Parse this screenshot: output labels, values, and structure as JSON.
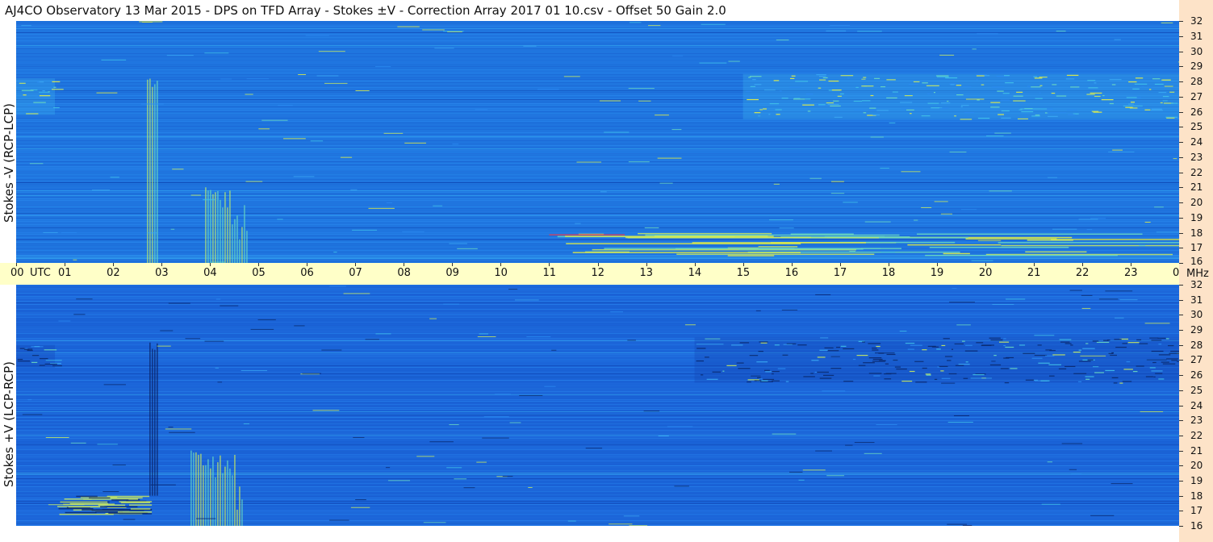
{
  "title": "AJ4CO Observatory  13 Mar 2015  -  DPS on TFD Array  -  Stokes ±V  -  Correction Array 2017 01 10.csv  -  Offset 50  Gain 2.0",
  "chart_data": {
    "type": "heatmap",
    "title": "AJ4CO Observatory  13 Mar 2015  -  DPS on TFD Array  -  Stokes ±V  -  Correction Array 2017 01 10.csv  -  Offset 50  Gain 2.0",
    "x_axis": {
      "unit": "UTC",
      "range": [
        0,
        24
      ],
      "tick_labels": [
        "00",
        "01",
        "02",
        "03",
        "04",
        "05",
        "06",
        "07",
        "08",
        "09",
        "10",
        "11",
        "12",
        "13",
        "14",
        "15",
        "16",
        "17",
        "18",
        "19",
        "20",
        "21",
        "22",
        "23",
        "00"
      ]
    },
    "y_axis": {
      "unit": "MHz",
      "range": [
        16,
        32
      ],
      "tick_labels": [
        "32",
        "31",
        "30",
        "29",
        "28",
        "27",
        "26",
        "25",
        "24",
        "23",
        "22",
        "21",
        "20",
        "19",
        "18",
        "17",
        "16"
      ]
    },
    "panels": [
      {
        "label": "Stokes -V (RCP-LCP)",
        "base_color": "#1f77e0",
        "features": [
          {
            "kind": "noise band",
            "freq_range_mhz": [
              25.5,
              28.5
            ],
            "time_range_utc": [
              15,
              24
            ]
          },
          {
            "kind": "noise band",
            "freq_range_mhz": [
              25.8,
              28.2
            ],
            "time_range_utc": [
              0,
              0.8
            ]
          },
          {
            "kind": "burst",
            "time_range_utc": [
              2.7,
              2.95
            ],
            "freq_range_mhz": [
              16,
              28.2
            ]
          },
          {
            "kind": "burst",
            "time_range_utc": [
              3.9,
              4.8
            ],
            "freq_range_mhz": [
              16,
              21
            ]
          },
          {
            "kind": "interference",
            "freq_range_mhz": [
              16.5,
              18
            ],
            "time_range_utc": [
              11,
              24
            ]
          }
        ]
      },
      {
        "label": "Stokes +V (LCP-RCP)",
        "base_color": "#1a63d8",
        "features": [
          {
            "kind": "noise band",
            "freq_range_mhz": [
              25.5,
              28.5
            ],
            "time_range_utc": [
              14,
              24
            ]
          },
          {
            "kind": "noise band",
            "freq_range_mhz": [
              26.5,
              28
            ],
            "time_range_utc": [
              0,
              0.8
            ]
          },
          {
            "kind": "burst",
            "time_range_utc": [
              2.75,
              2.95
            ],
            "freq_range_mhz": [
              18,
              28.2
            ]
          },
          {
            "kind": "burst",
            "time_range_utc": [
              3.6,
              4.7
            ],
            "freq_range_mhz": [
              16,
              21
            ]
          },
          {
            "kind": "interference",
            "freq_range_mhz": [
              16.8,
              18
            ],
            "time_range_utc": [
              0.8,
              2.8
            ]
          }
        ]
      }
    ]
  },
  "axis": {
    "utc_label": "UTC",
    "unit_label": "MHz"
  },
  "colors": {
    "time_axis_bg": "#ffffc8",
    "freq_axis_bg": "#fde3c8"
  }
}
